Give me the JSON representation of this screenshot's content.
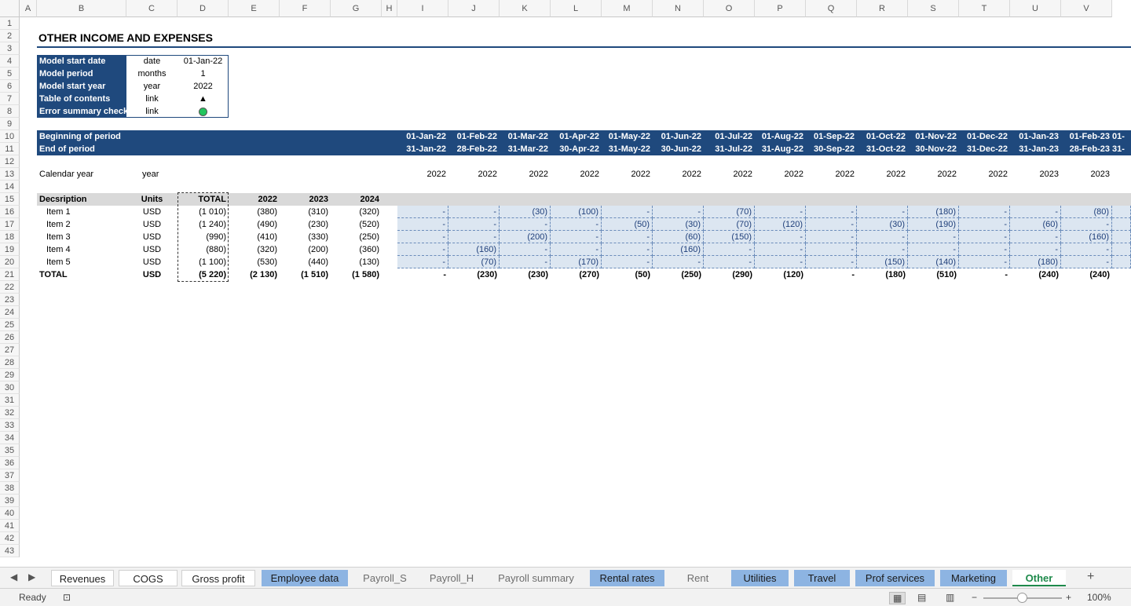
{
  "columns": [
    "A",
    "B",
    "C",
    "D",
    "E",
    "F",
    "G",
    "H",
    "I",
    "J",
    "K",
    "L",
    "M",
    "N",
    "O",
    "P",
    "Q",
    "R",
    "S",
    "T",
    "U",
    "V"
  ],
  "rows": [
    "1",
    "2",
    "3",
    "4",
    "5",
    "6",
    "7",
    "8",
    "9",
    "10",
    "11",
    "12",
    "13",
    "14",
    "15",
    "16",
    "17",
    "18",
    "19",
    "20",
    "21",
    "22",
    "23",
    "24",
    "25",
    "26",
    "27",
    "28",
    "29",
    "30",
    "31",
    "32",
    "33",
    "34",
    "35",
    "36",
    "37",
    "38",
    "39",
    "40",
    "41",
    "42",
    "43"
  ],
  "title": "OTHER INCOME AND EXPENSES",
  "info": [
    {
      "label": "Model start date",
      "unit": "date",
      "value": "01-Jan-22"
    },
    {
      "label": "Model period",
      "unit": "months",
      "value": "1"
    },
    {
      "label": "Model start year",
      "unit": "year",
      "value": "2022"
    },
    {
      "label": "Table of contents",
      "unit": "link",
      "value": "▲"
    },
    {
      "label": "Error summary check",
      "unit": "link",
      "value": ""
    }
  ],
  "status_color": "#22c55e",
  "period": {
    "beginning_label": "Beginning of period",
    "end_label": "End of period",
    "beginning": [
      "01-Jan-22",
      "01-Feb-22",
      "01-Mar-22",
      "01-Apr-22",
      "01-May-22",
      "01-Jun-22",
      "01-Jul-22",
      "01-Aug-22",
      "01-Sep-22",
      "01-Oct-22",
      "01-Nov-22",
      "01-Dec-22",
      "01-Jan-23",
      "01-Feb-23",
      "01-"
    ],
    "end": [
      "31-Jan-22",
      "28-Feb-22",
      "31-Mar-22",
      "30-Apr-22",
      "31-May-22",
      "30-Jun-22",
      "31-Jul-22",
      "31-Aug-22",
      "30-Sep-22",
      "31-Oct-22",
      "30-Nov-22",
      "31-Dec-22",
      "31-Jan-23",
      "28-Feb-23",
      "31-"
    ]
  },
  "calendar": {
    "label": "Calendar year",
    "unit": "year",
    "years": [
      "2022",
      "2022",
      "2022",
      "2022",
      "2022",
      "2022",
      "2022",
      "2022",
      "2022",
      "2022",
      "2022",
      "2022",
      "2023",
      "2023"
    ]
  },
  "table": {
    "headers": {
      "desc": "Decsription",
      "units": "Units",
      "total": "TOTAL",
      "y1": "2022",
      "y2": "2023",
      "y3": "2024"
    },
    "items": [
      {
        "name": "Item 1",
        "units": "USD",
        "total": "(1 010)",
        "y1": "(380)",
        "y2": "(310)",
        "y3": "(320)",
        "months": [
          "-",
          "-",
          "(30)",
          "(100)",
          "-",
          "-",
          "(70)",
          "-",
          "-",
          "-",
          "(180)",
          "-",
          "-",
          "(80)"
        ]
      },
      {
        "name": "Item 2",
        "units": "USD",
        "total": "(1 240)",
        "y1": "(490)",
        "y2": "(230)",
        "y3": "(520)",
        "months": [
          "-",
          "-",
          "-",
          "-",
          "(50)",
          "(30)",
          "(70)",
          "(120)",
          "-",
          "(30)",
          "(190)",
          "-",
          "(60)",
          "-"
        ]
      },
      {
        "name": "Item 3",
        "units": "USD",
        "total": "(990)",
        "y1": "(410)",
        "y2": "(330)",
        "y3": "(250)",
        "months": [
          "-",
          "-",
          "(200)",
          "-",
          "-",
          "(60)",
          "(150)",
          "-",
          "-",
          "-",
          "-",
          "-",
          "-",
          "(160)"
        ]
      },
      {
        "name": "Item 4",
        "units": "USD",
        "total": "(880)",
        "y1": "(320)",
        "y2": "(200)",
        "y3": "(360)",
        "months": [
          "-",
          "(160)",
          "-",
          "-",
          "-",
          "(160)",
          "-",
          "-",
          "-",
          "-",
          "-",
          "-",
          "-",
          "-"
        ]
      },
      {
        "name": "Item 5",
        "units": "USD",
        "total": "(1 100)",
        "y1": "(530)",
        "y2": "(440)",
        "y3": "(130)",
        "months": [
          "-",
          "(70)",
          "-",
          "(170)",
          "-",
          "-",
          "-",
          "-",
          "-",
          "(150)",
          "(140)",
          "-",
          "(180)",
          "-"
        ]
      }
    ],
    "total": {
      "name": "TOTAL",
      "units": "USD",
      "total": "(5 220)",
      "y1": "(2 130)",
      "y2": "(1 510)",
      "y3": "(1 580)",
      "months": [
        "-",
        "(230)",
        "(230)",
        "(270)",
        "(50)",
        "(250)",
        "(290)",
        "(120)",
        "-",
        "(180)",
        "(510)",
        "-",
        "(240)",
        "(240)"
      ]
    }
  },
  "tabs": [
    {
      "label": "Revenues",
      "style": "white"
    },
    {
      "label": "COGS",
      "style": "white"
    },
    {
      "label": "Gross profit",
      "style": "white"
    },
    {
      "label": "Employee data",
      "style": "colored"
    },
    {
      "label": "Payroll_S",
      "style": "plain"
    },
    {
      "label": "Payroll_H",
      "style": "plain"
    },
    {
      "label": "Payroll summary",
      "style": "plain"
    },
    {
      "label": "Rental rates",
      "style": "colored"
    },
    {
      "label": "Rent",
      "style": "plain"
    },
    {
      "label": "Utilities",
      "style": "colored"
    },
    {
      "label": "Travel",
      "style": "colored"
    },
    {
      "label": "Prof services",
      "style": "colored"
    },
    {
      "label": "Marketing",
      "style": "colored"
    },
    {
      "label": "Other",
      "style": "active"
    }
  ],
  "add_sheet": "+",
  "status": {
    "ready": "Ready",
    "zoom": "100%"
  }
}
